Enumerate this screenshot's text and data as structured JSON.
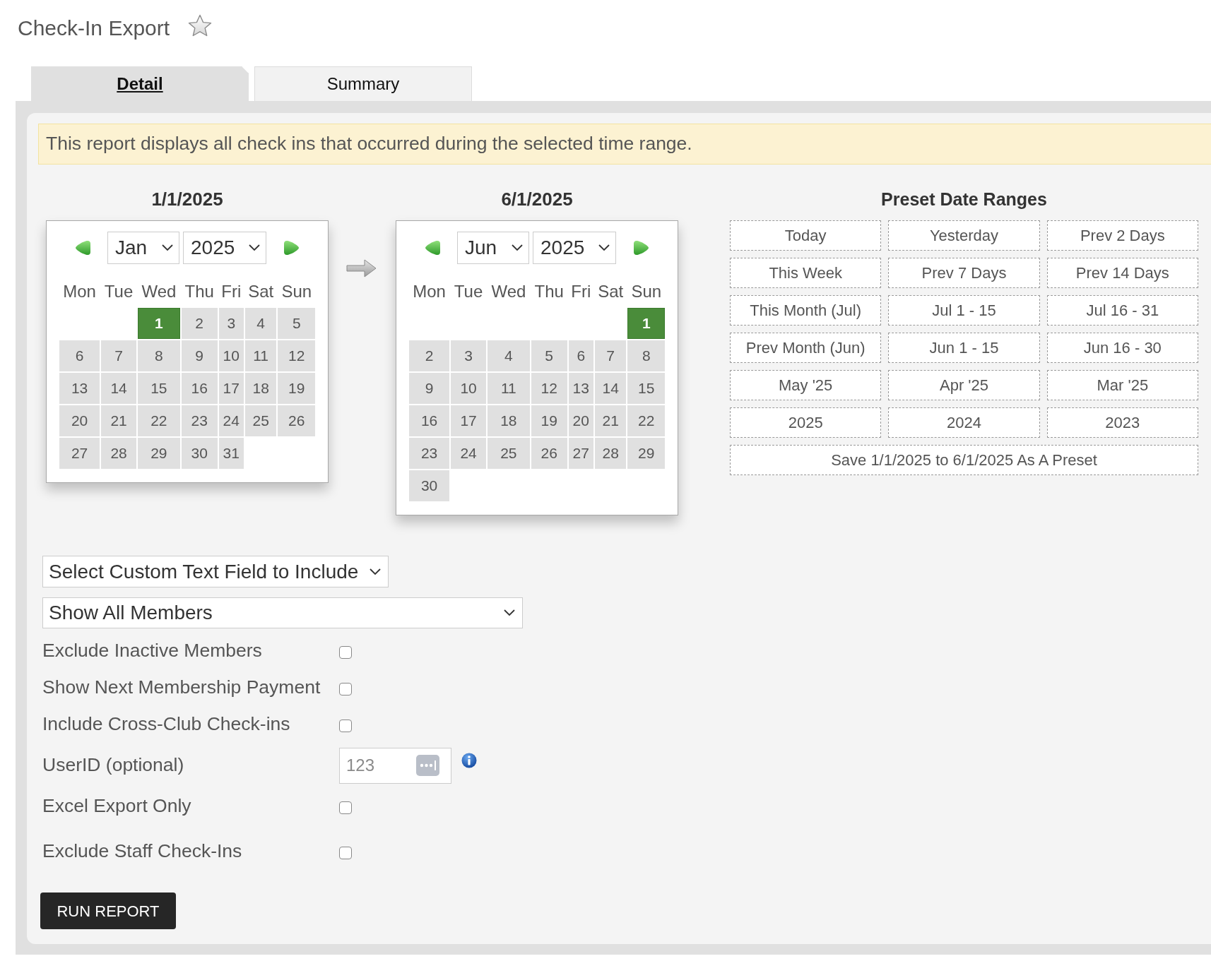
{
  "page": {
    "title": "Check-In Export"
  },
  "tabs": [
    {
      "label": "Detail",
      "selected": true
    },
    {
      "label": "Summary",
      "selected": false
    }
  ],
  "notice": "This report displays all check ins that occurred during the selected time range.",
  "calendars": [
    {
      "heading": "1/1/2025",
      "month": "Jan",
      "year": "2025",
      "weekdays": [
        "Mon",
        "Tue",
        "Wed",
        "Thu",
        "Fri",
        "Sat",
        "Sun"
      ],
      "weeks": [
        [
          {
            "label": "1",
            "selected": true
          },
          {
            "label": "2",
            "selected": false
          },
          {
            "label": "3",
            "selected": false
          },
          {
            "label": "4",
            "selected": false
          },
          {
            "label": "5",
            "selected": false
          }
        ],
        [
          {
            "label": "6",
            "selected": false
          },
          {
            "label": "7",
            "selected": false
          },
          {
            "label": "8",
            "selected": false
          },
          {
            "label": "9",
            "selected": false
          },
          {
            "label": "10",
            "selected": false
          },
          {
            "label": "11",
            "selected": false
          },
          {
            "label": "12",
            "selected": false
          }
        ],
        [
          {
            "label": "13",
            "selected": false
          },
          {
            "label": "14",
            "selected": false
          },
          {
            "label": "15",
            "selected": false
          },
          {
            "label": "16",
            "selected": false
          },
          {
            "label": "17",
            "selected": false
          },
          {
            "label": "18",
            "selected": false
          },
          {
            "label": "19",
            "selected": false
          }
        ],
        [
          {
            "label": "20",
            "selected": false
          },
          {
            "label": "21",
            "selected": false
          },
          {
            "label": "22",
            "selected": false
          },
          {
            "label": "23",
            "selected": false
          },
          {
            "label": "24",
            "selected": false
          },
          {
            "label": "25",
            "selected": false
          },
          {
            "label": "26",
            "selected": false
          }
        ],
        [
          {
            "label": "27",
            "selected": false
          },
          {
            "label": "28",
            "selected": false
          },
          {
            "label": "29",
            "selected": false
          },
          {
            "label": "30",
            "selected": false
          },
          {
            "label": "31",
            "selected": false
          }
        ]
      ]
    },
    {
      "heading": "6/1/2025",
      "month": "Jun",
      "year": "2025",
      "weekdays": [
        "Mon",
        "Tue",
        "Wed",
        "Thu",
        "Fri",
        "Sat",
        "Sun"
      ],
      "weeks": [
        [
          {
            "label": "1",
            "selected": true
          }
        ],
        [
          {
            "label": "2",
            "selected": false
          },
          {
            "label": "3",
            "selected": false
          },
          {
            "label": "4",
            "selected": false
          },
          {
            "label": "5",
            "selected": false
          },
          {
            "label": "6",
            "selected": false
          },
          {
            "label": "7",
            "selected": false
          },
          {
            "label": "8",
            "selected": false
          }
        ],
        [
          {
            "label": "9",
            "selected": false
          },
          {
            "label": "10",
            "selected": false
          },
          {
            "label": "11",
            "selected": false
          },
          {
            "label": "12",
            "selected": false
          },
          {
            "label": "13",
            "selected": false
          },
          {
            "label": "14",
            "selected": false
          },
          {
            "label": "15",
            "selected": false
          }
        ],
        [
          {
            "label": "16",
            "selected": false
          },
          {
            "label": "17",
            "selected": false
          },
          {
            "label": "18",
            "selected": false
          },
          {
            "label": "19",
            "selected": false
          },
          {
            "label": "20",
            "selected": false
          },
          {
            "label": "21",
            "selected": false
          },
          {
            "label": "22",
            "selected": false
          }
        ],
        [
          {
            "label": "23",
            "selected": false
          },
          {
            "label": "24",
            "selected": false
          },
          {
            "label": "25",
            "selected": false
          },
          {
            "label": "26",
            "selected": false
          },
          {
            "label": "27",
            "selected": false
          },
          {
            "label": "28",
            "selected": false
          },
          {
            "label": "29",
            "selected": false
          }
        ],
        [
          {
            "label": "30",
            "selected": false
          }
        ]
      ]
    }
  ],
  "preset_ranges": {
    "title": "Preset Date Ranges",
    "options": [
      "Today",
      "Yesterday",
      "Prev 2 Days",
      "This Week",
      "Prev 7 Days",
      "Prev 14 Days",
      "This Month (Jul)",
      "Jul 1 - 15",
      "Jul 16 - 31",
      "Prev Month (Jun)",
      "Jun 1 - 15",
      "Jun 16 - 30",
      "May '25",
      "Apr '25",
      "Mar '25",
      "2025",
      "2024",
      "2023"
    ],
    "save_label": "Save 1/1/2025 to 6/1/2025 As A Preset"
  },
  "custom_field_select": {
    "value": "Select Custom Text Field to Include"
  },
  "member_select": {
    "value": "Show All Members"
  },
  "options": [
    {
      "kind": "checkbox",
      "label": "Exclude Inactive Members",
      "checked": false
    },
    {
      "kind": "checkbox",
      "label": "Show Next Membership Payment",
      "checked": false
    },
    {
      "kind": "checkbox",
      "label": "Include Cross-Club Check-ins",
      "checked": false
    },
    {
      "kind": "text",
      "label": "UserID (optional)",
      "placeholder": "123"
    },
    {
      "kind": "checkbox",
      "label": "Excel Export Only",
      "checked": false
    },
    {
      "kind": "checkbox",
      "label": "Exclude Staff Check-Ins",
      "checked": false
    }
  ],
  "run_button": {
    "label": "RUN REPORT"
  }
}
